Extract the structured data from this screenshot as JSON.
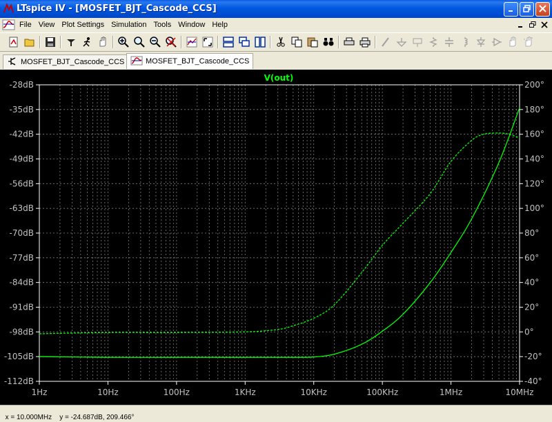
{
  "window": {
    "title": "LTspice IV - [MOSFET_BJT_Cascode_CCS]"
  },
  "menu": {
    "items": [
      "File",
      "View",
      "Plot Settings",
      "Simulation",
      "Tools",
      "Window",
      "Help"
    ]
  },
  "toolbar": {
    "icons": [
      "new-schematic-icon",
      "open-icon",
      "save-icon",
      "control-panel-icon",
      "run-icon",
      "halt-icon",
      "zoom-in-icon",
      "zoom-out-icon",
      "zoom-pan-icon",
      "zoom-cancel-icon",
      "autoscale-icon",
      "zoom-fit-icon",
      "tile-horizontal-icon",
      "cascade-icon",
      "tile-vertical-icon",
      "cut-icon",
      "copy-icon",
      "paste-icon",
      "find-icon",
      "print-setup-icon",
      "print-icon",
      "wire-icon",
      "ground-icon",
      "label-icon",
      "resistor-icon",
      "capacitor-icon",
      "inductor-icon",
      "diode-icon",
      "component-icon",
      "move-icon",
      "drag-icon"
    ]
  },
  "tabs": [
    {
      "label": "MOSFET_BJT_Cascode_CCS",
      "icon": "schematic-icon",
      "active": false
    },
    {
      "label": "MOSFET_BJT_Cascode_CCS",
      "icon": "waveform-icon",
      "active": true
    }
  ],
  "plot": {
    "trace_name": "V(out)",
    "trace_color": "#00ff00",
    "background": "#000000",
    "grid_color": "#808080"
  },
  "chart_data": {
    "type": "line",
    "title": "V(out)",
    "x_scale": "log",
    "xlim": [
      1,
      10000000
    ],
    "x_tick_values": [
      1,
      10,
      100,
      1000,
      10000,
      100000,
      1000000,
      10000000
    ],
    "x_tick_labels": [
      "1Hz",
      "10Hz",
      "100Hz",
      "1KHz",
      "10KHz",
      "100KHz",
      "1MHz",
      "10MHz"
    ],
    "y_left": {
      "unit": "dB",
      "ylim": [
        -112,
        -28
      ],
      "tick_labels": [
        "-28dB",
        "-35dB",
        "-42dB",
        "-49dB",
        "-56dB",
        "-63dB",
        "-70dB",
        "-77dB",
        "-84dB",
        "-91dB",
        "-98dB",
        "-105dB",
        "-112dB"
      ],
      "tick_values": [
        -28,
        -35,
        -42,
        -49,
        -56,
        -63,
        -70,
        -77,
        -84,
        -91,
        -98,
        -105,
        -112
      ]
    },
    "y_right": {
      "unit": "°",
      "ylim": [
        -40,
        200
      ],
      "tick_labels": [
        "200°",
        "180°",
        "160°",
        "140°",
        "120°",
        "100°",
        "80°",
        "60°",
        "40°",
        "20°",
        "0°",
        "-20°",
        "-40°"
      ],
      "tick_values": [
        200,
        180,
        160,
        140,
        120,
        100,
        80,
        60,
        40,
        20,
        0,
        -20,
        -40
      ]
    },
    "grid": true,
    "series": [
      {
        "name": "V(out) magnitude",
        "axis": "left",
        "style": "solid",
        "color": "#00ff00",
        "x": [
          1,
          10,
          100,
          1000,
          5000,
          10000,
          20000,
          50000,
          100000,
          200000,
          500000,
          1000000,
          2000000,
          5000000,
          10000000
        ],
        "y": [
          -105.0,
          -105.2,
          -105.2,
          -105.2,
          -105.2,
          -105.1,
          -104.3,
          -101.5,
          -97.8,
          -93.0,
          -84.0,
          -75.5,
          -66.0,
          -50.0,
          -34.5
        ]
      },
      {
        "name": "V(out) phase",
        "axis": "right",
        "style": "dashed",
        "color": "#00ff00",
        "x": [
          1,
          10,
          100,
          1000,
          3000,
          5000,
          10000,
          20000,
          50000,
          100000,
          200000,
          500000,
          1000000,
          2000000,
          3000000,
          5000000,
          7000000,
          10000000
        ],
        "y": [
          -1.5,
          -0.5,
          -0.5,
          0,
          2,
          5,
          11,
          22,
          48,
          70,
          88,
          112,
          138,
          155,
          160,
          161,
          160,
          157
        ]
      }
    ]
  },
  "status": {
    "text": "x = 10.000MHz    y = -24.687dB, 209.466°"
  }
}
